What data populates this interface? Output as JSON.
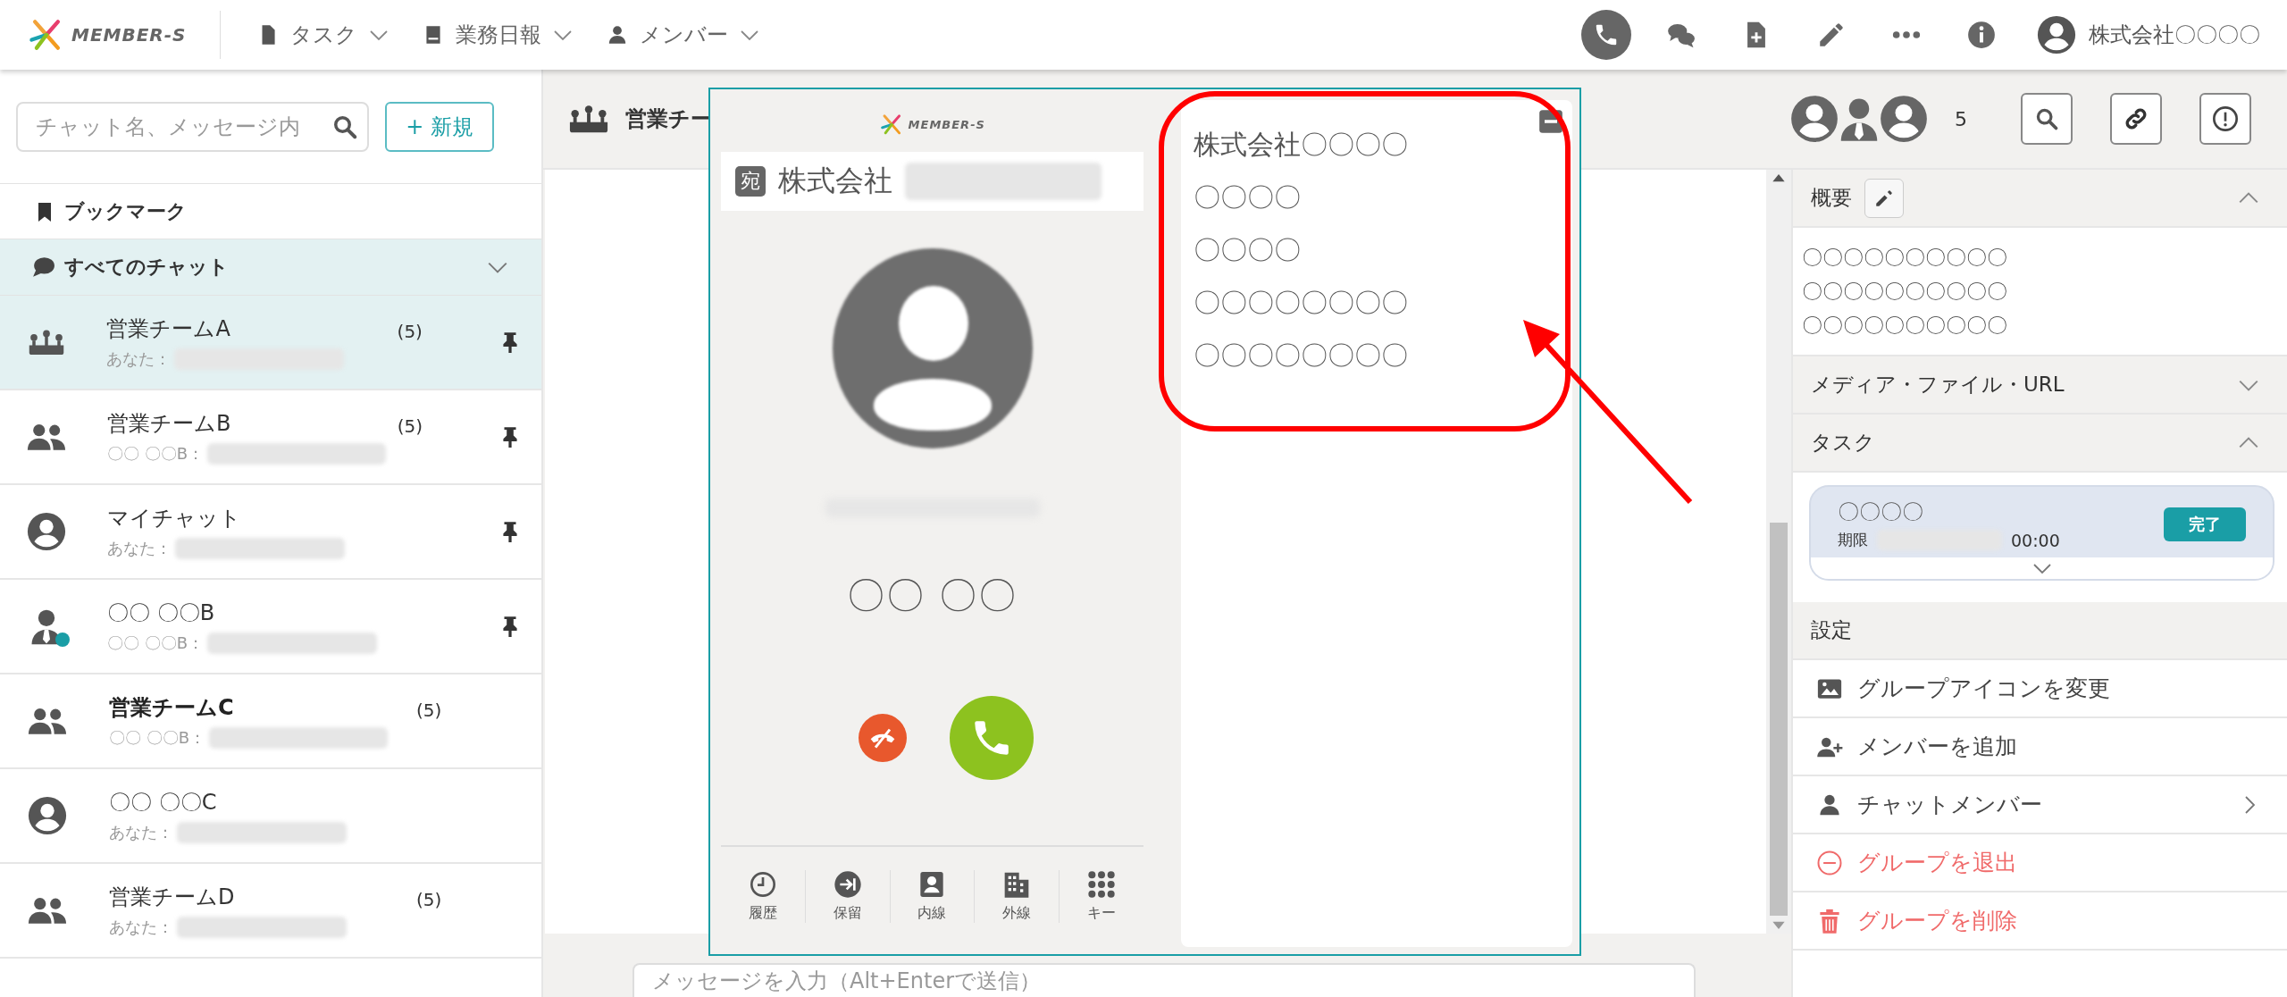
{
  "topbar": {
    "logo": "MEMBER-S",
    "nav": [
      {
        "label": "タスク"
      },
      {
        "label": "業務日報"
      },
      {
        "label": "メンバー"
      }
    ],
    "actions": [
      {
        "active": true
      },
      {
        "active": false
      },
      {
        "active": false
      },
      {
        "active": false
      },
      {
        "active": false
      },
      {
        "active": false
      }
    ],
    "account": "株式会社〇〇〇〇"
  },
  "sidebar": {
    "search": {
      "placeholder": "チャット名、メッセージ内"
    },
    "new_button": "+ 新規",
    "bookmark": "ブックマーク",
    "all_chats": "すべてのチャット",
    "chats": [
      {
        "name": "営業チームA",
        "kind": "crowd",
        "count": "(5)",
        "sender": "あなた：",
        "pinned": true,
        "unread": false,
        "online": false,
        "selected": true
      },
      {
        "name": "営業チームB",
        "kind": "group",
        "count": "(5)",
        "sender": "〇〇 〇〇B：",
        "pinned": true,
        "unread": false,
        "online": false,
        "selected": false
      },
      {
        "name": "マイチャット",
        "kind": "avatar",
        "sender": "あなた：",
        "pinned": true,
        "unread": false,
        "online": false,
        "selected": false
      },
      {
        "name": "〇〇 〇〇B",
        "kind": "member",
        "sender": "〇〇 〇〇B：",
        "pinned": true,
        "unread": false,
        "online": true,
        "selected": false
      },
      {
        "name": "営業チームC",
        "kind": "group",
        "count": "(5)",
        "sender": "〇〇 〇〇B：",
        "pinned": false,
        "unread": true,
        "online": false,
        "selected": false
      },
      {
        "name": "〇〇 〇〇C",
        "kind": "avatar",
        "sender": "あなた：",
        "pinned": false,
        "unread": false,
        "online": false,
        "selected": false
      },
      {
        "name": "営業チームD",
        "kind": "group",
        "count": "(5)",
        "sender": "あなた：",
        "pinned": false,
        "unread": false,
        "online": false,
        "selected": false
      }
    ]
  },
  "chat": {
    "title": "営業チー",
    "members": [
      {
        "kind": "avatar"
      },
      {
        "kind": "member"
      },
      {
        "kind": "avatar"
      }
    ],
    "member_count": "5",
    "input": {
      "placeholder": "メッセージを入力（Alt+Enterで送信）"
    }
  },
  "call_dialog": {
    "logo": "MEMBER-S",
    "address_badge": "宛",
    "company": "株式会社",
    "number": "〇〇 〇〇",
    "tabs": [
      {
        "label": "履歴"
      },
      {
        "label": "保留"
      },
      {
        "label": "内線"
      },
      {
        "label": "外線"
      },
      {
        "label": "キー"
      }
    ],
    "details": [
      "株式会社〇〇〇〇",
      "〇〇〇〇",
      "〇〇〇〇",
      "〇〇〇〇〇〇〇〇",
      "〇〇〇〇〇〇〇〇"
    ]
  },
  "info_panel": {
    "overview": {
      "title": "概要",
      "expanded": true,
      "lines": [
        "〇〇〇〇〇〇〇〇〇〇",
        "〇〇〇〇〇〇〇〇〇〇",
        "〇〇〇〇〇〇〇〇〇〇"
      ]
    },
    "media": {
      "title": "メディア・ファイル・URL",
      "expanded": false
    },
    "tasks": {
      "title": "タスク",
      "expanded": true,
      "items": [
        {
          "title": "〇〇〇〇",
          "due_label": "期限",
          "due_time": "00:00",
          "done_button": "完了"
        }
      ]
    },
    "settings": {
      "title": "設定",
      "items": [
        {
          "label": "グループアイコンを変更",
          "kind": "normal",
          "submenu": false
        },
        {
          "label": "メンバーを追加",
          "kind": "normal",
          "submenu": false
        },
        {
          "label": "チャットメンバー",
          "kind": "normal",
          "submenu": true
        },
        {
          "label": "グループを退出",
          "kind": "danger",
          "submenu": false
        },
        {
          "label": "グループを削除",
          "kind": "danger",
          "submenu": false
        }
      ]
    }
  }
}
